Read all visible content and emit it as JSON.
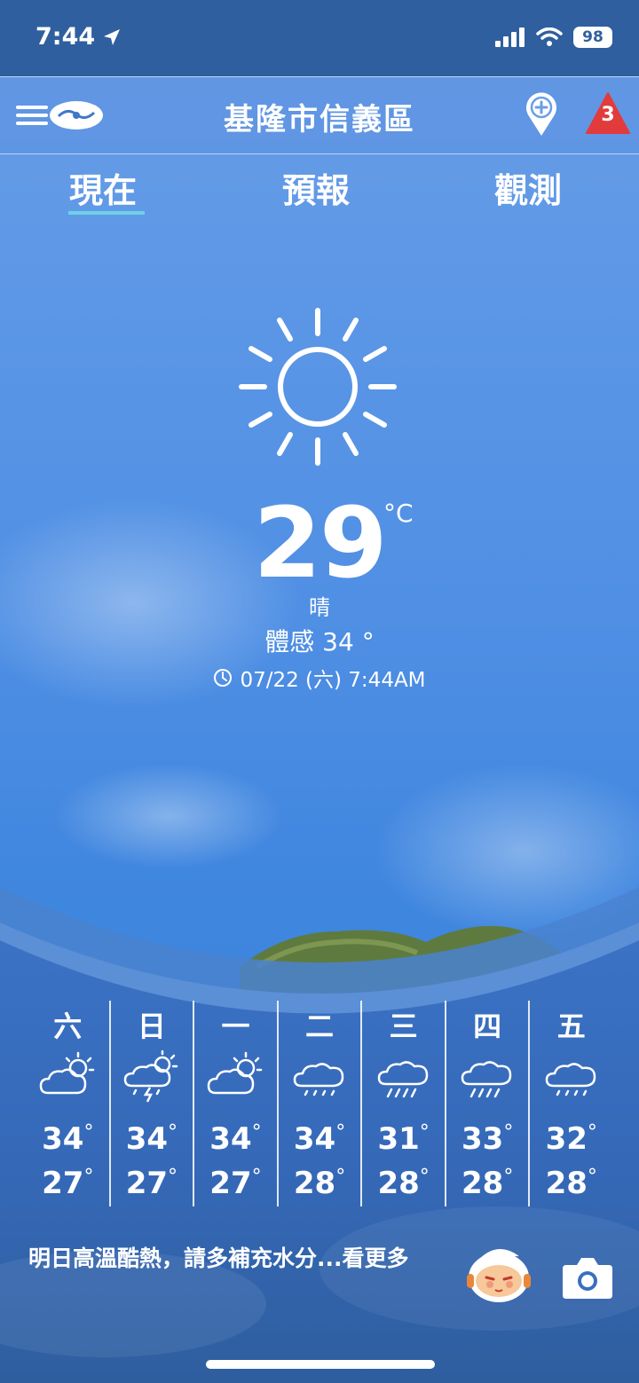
{
  "status_bar": {
    "time": "7:44",
    "battery": "98",
    "icons": [
      "location-arrow-icon",
      "cellular-signal-icon",
      "wifi-icon",
      "battery-icon"
    ]
  },
  "header": {
    "title": "基隆市信義區",
    "alert_count": "3",
    "icons": [
      "menu-icon",
      "cwa-logo-icon",
      "add-location-icon",
      "warning-triangle-icon"
    ]
  },
  "tabs": [
    {
      "label": "現在",
      "active": true
    },
    {
      "label": "預報",
      "active": false
    },
    {
      "label": "觀測",
      "active": false
    }
  ],
  "current": {
    "icon": "sun-icon",
    "temperature": "29",
    "unit": "°C",
    "condition": "晴",
    "feels_like": "體感 34 °",
    "observed_at": "07/22 (六) 7:44AM"
  },
  "forecast": [
    {
      "day": "六",
      "icon": "partly-cloudy-icon",
      "high": "34",
      "low": "27"
    },
    {
      "day": "日",
      "icon": "thunderstorm-sun-icon",
      "high": "34",
      "low": "27"
    },
    {
      "day": "一",
      "icon": "partly-cloudy-icon",
      "high": "34",
      "low": "27"
    },
    {
      "day": "二",
      "icon": "cloud-light-rain-icon",
      "high": "34",
      "low": "28"
    },
    {
      "day": "三",
      "icon": "rain-icon",
      "high": "31",
      "low": "28"
    },
    {
      "day": "四",
      "icon": "rain-icon",
      "high": "33",
      "low": "28"
    },
    {
      "day": "五",
      "icon": "cloud-light-rain-icon",
      "high": "32",
      "low": "28"
    }
  ],
  "footer": {
    "tip": "明日高溫酷熱，請多補充水分...看更多",
    "icons": [
      "mascot-icon",
      "camera-icon"
    ]
  },
  "colors": {
    "status_bar": "#2f5f9e",
    "sky": "#4f8fe4",
    "tab_underline": "#6fd0e8",
    "alert_red": "#e23b3b"
  }
}
